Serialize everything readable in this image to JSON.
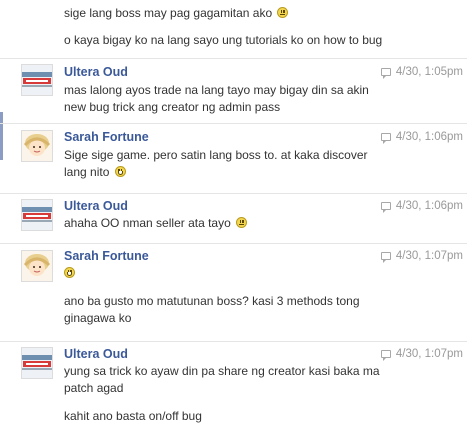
{
  "conversation": {
    "top": {
      "lines": [
        {
          "text": "sige lang boss may pag gagamitan ako",
          "emoticon": "neutral-smiley-icon"
        },
        {
          "text": "o kaya bigay ko na lang sayo ung tutorials ko on how to bug",
          "emoticon": null
        }
      ]
    },
    "groups": [
      {
        "sender": "Ultera Oud",
        "avatar": "ultera-oud-avatar",
        "time": "4/30, 1:05pm",
        "lines": [
          {
            "text": "mas lalong ayos trade na lang tayo may bigay din sa akin"
          },
          {
            "text": "new bug trick ang creator ng admin pass"
          }
        ]
      },
      {
        "sender": "Sarah Fortune",
        "avatar": "sarah-fortune-avatar",
        "time": "4/30, 1:06pm",
        "lines": [
          {
            "text": "Sige sige game. pero satin lang boss to. at kaka discover"
          },
          {
            "text": "lang nito",
            "emoticon": "grin-smiley-icon"
          }
        ]
      },
      {
        "sender": "Ultera Oud",
        "avatar": "ultera-oud-avatar",
        "time": "4/30, 1:06pm",
        "lines": [
          {
            "text": "ahaha OO nman seller ata tayo",
            "emoticon": "neutral-smiley-icon"
          }
        ]
      },
      {
        "sender": "Sarah Fortune",
        "avatar": "sarah-fortune-avatar",
        "time": "4/30, 1:07pm",
        "lines": [
          {
            "text": "",
            "emoticon": "grin-smiley-icon"
          },
          {
            "text": "ano ba gusto mo matutunan boss? kasi 3 methods tong"
          },
          {
            "text": "ginagawa ko"
          }
        ]
      },
      {
        "sender": "Ultera Oud",
        "avatar": "ultera-oud-avatar",
        "time": "4/30, 1:07pm",
        "lines": [
          {
            "text": "yung sa trick ko ayaw din pa share ng creator kasi baka ma"
          },
          {
            "text": "patch agad"
          },
          {
            "text": "kahit ano basta on/off bug"
          }
        ]
      }
    ]
  },
  "colors": {
    "sender": "#3b5998",
    "text": "#333333",
    "timestamp": "#999999",
    "separator": "#e5e5e5"
  }
}
